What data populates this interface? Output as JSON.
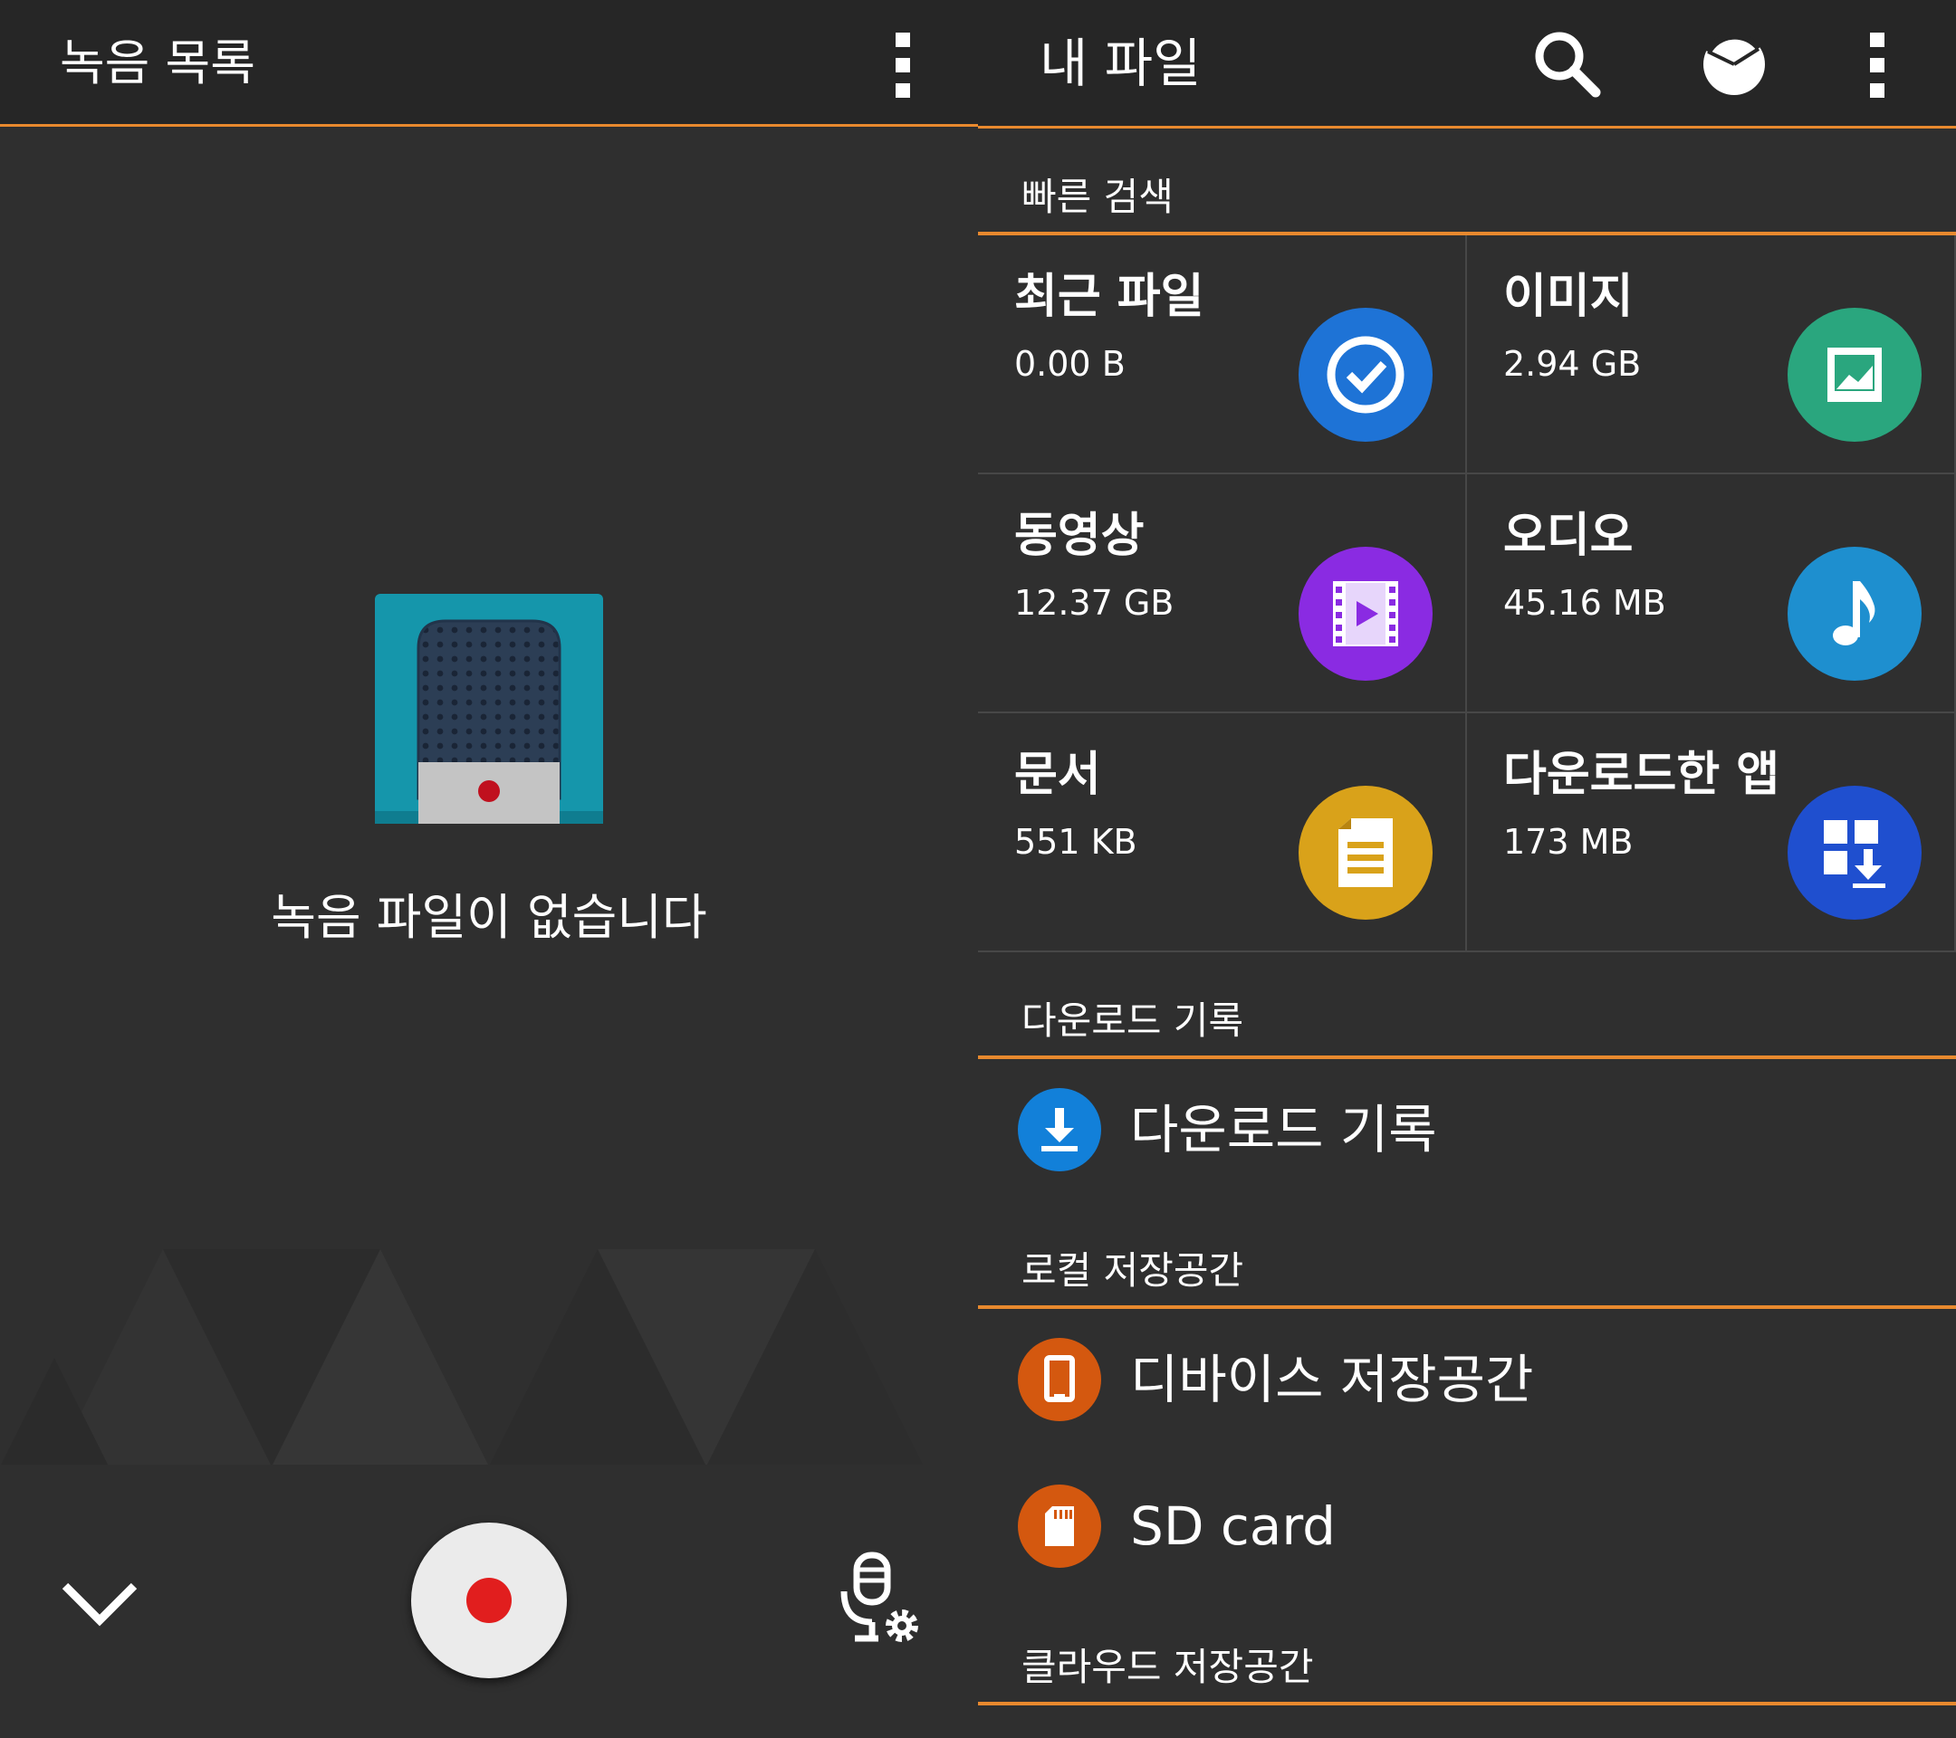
{
  "colors": {
    "accent": "#e8892e",
    "topbar_bg": "#262626",
    "pane_bg": "#2f2f2f",
    "record_dot": "#e11e1e",
    "recent_blue": "#1e73d6",
    "image_green": "#2aa67e",
    "video_purple": "#8a2be2",
    "audio_blue": "#1e8fcf",
    "document_yellow": "#d9a21a",
    "apps_blue": "#1f4fcf",
    "download_blue": "#1280d9",
    "storage_orange": "#d4580f"
  },
  "recorder": {
    "title": "녹음 목록",
    "menu_icon": "more-vert-icon",
    "empty_message": "녹음 파일이 없습니다",
    "illustration_icon": "microphone-illustration-icon",
    "collapse_icon": "chevron-down-icon",
    "record_icon": "record-icon",
    "settings_icon": "mic-settings-icon"
  },
  "files": {
    "title": "내 파일",
    "actions": [
      "search-icon",
      "storage-chart-icon",
      "more-vert-icon"
    ],
    "quick_search": {
      "header": "빠른 검색",
      "categories": [
        {
          "name": "최근 파일",
          "size": "0.00 B",
          "icon": "recent-check-icon"
        },
        {
          "name": "이미지",
          "size": "2.94 GB",
          "icon": "image-icon"
        },
        {
          "name": "동영상",
          "size": "12.37 GB",
          "icon": "video-icon"
        },
        {
          "name": "오디오",
          "size": "45.16 MB",
          "icon": "music-note-icon"
        },
        {
          "name": "문서",
          "size": "551 KB",
          "icon": "document-icon"
        },
        {
          "name": "다운로드한 앱",
          "size": "173 MB",
          "icon": "downloaded-apps-icon"
        }
      ]
    },
    "download_history": {
      "header": "다운로드 기록",
      "item": "다운로드 기록"
    },
    "local_storage": {
      "header": "로컬 저장공간",
      "items": [
        "디바이스 저장공간",
        "SD card"
      ]
    },
    "cloud_storage": {
      "header": "클라우드 저장공간"
    }
  }
}
